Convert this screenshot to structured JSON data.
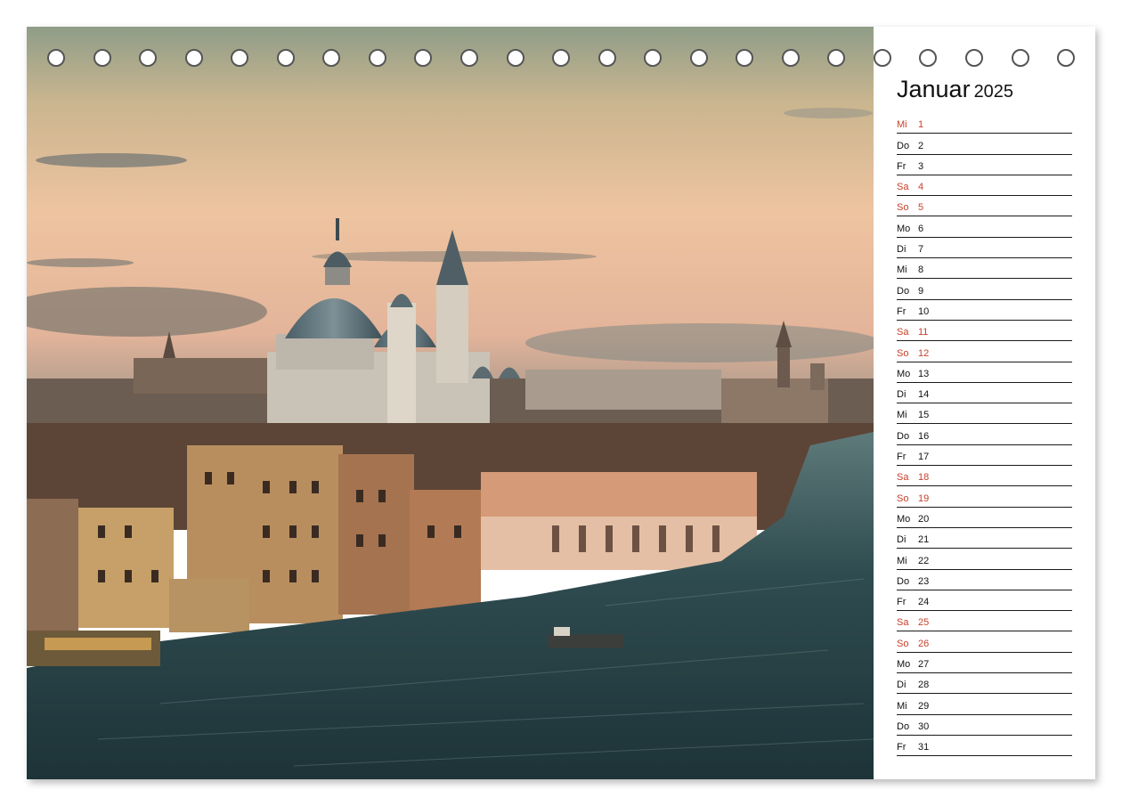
{
  "calendar": {
    "month": "Januar",
    "year": "2025",
    "weekend_color": "#c8402a",
    "days": [
      {
        "name": "Mi",
        "num": "1",
        "weekend": true
      },
      {
        "name": "Do",
        "num": "2",
        "weekend": false
      },
      {
        "name": "Fr",
        "num": "3",
        "weekend": false
      },
      {
        "name": "Sa",
        "num": "4",
        "weekend": true
      },
      {
        "name": "So",
        "num": "5",
        "weekend": true
      },
      {
        "name": "Mo",
        "num": "6",
        "weekend": false
      },
      {
        "name": "Di",
        "num": "7",
        "weekend": false
      },
      {
        "name": "Mi",
        "num": "8",
        "weekend": false
      },
      {
        "name": "Do",
        "num": "9",
        "weekend": false
      },
      {
        "name": "Fr",
        "num": "10",
        "weekend": false
      },
      {
        "name": "Sa",
        "num": "11",
        "weekend": true
      },
      {
        "name": "So",
        "num": "12",
        "weekend": true
      },
      {
        "name": "Mo",
        "num": "13",
        "weekend": false
      },
      {
        "name": "Di",
        "num": "14",
        "weekend": false
      },
      {
        "name": "Mi",
        "num": "15",
        "weekend": false
      },
      {
        "name": "Do",
        "num": "16",
        "weekend": false
      },
      {
        "name": "Fr",
        "num": "17",
        "weekend": false
      },
      {
        "name": "Sa",
        "num": "18",
        "weekend": true
      },
      {
        "name": "So",
        "num": "19",
        "weekend": true
      },
      {
        "name": "Mo",
        "num": "20",
        "weekend": false
      },
      {
        "name": "Di",
        "num": "21",
        "weekend": false
      },
      {
        "name": "Mi",
        "num": "22",
        "weekend": false
      },
      {
        "name": "Do",
        "num": "23",
        "weekend": false
      },
      {
        "name": "Fr",
        "num": "24",
        "weekend": false
      },
      {
        "name": "Sa",
        "num": "25",
        "weekend": true
      },
      {
        "name": "So",
        "num": "26",
        "weekend": true
      },
      {
        "name": "Mo",
        "num": "27",
        "weekend": false
      },
      {
        "name": "Di",
        "num": "28",
        "weekend": false
      },
      {
        "name": "Mi",
        "num": "29",
        "weekend": false
      },
      {
        "name": "Do",
        "num": "30",
        "weekend": false
      },
      {
        "name": "Fr",
        "num": "31",
        "weekend": false
      }
    ]
  },
  "binding": {
    "ring_count": 23
  },
  "photo": {
    "icon": "venice-grand-canal-photo"
  }
}
